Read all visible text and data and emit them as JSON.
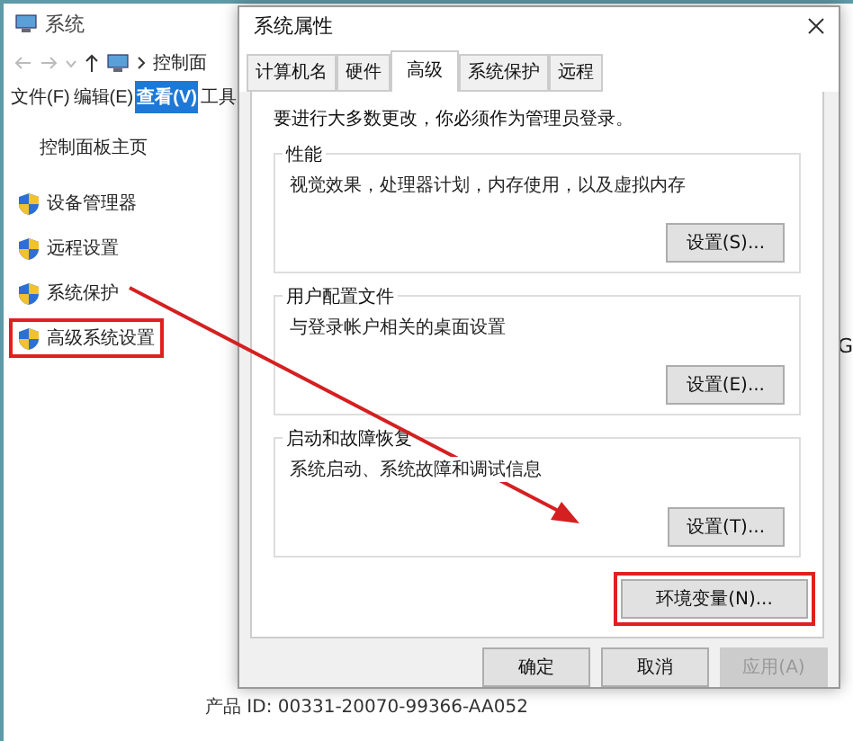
{
  "background_window": {
    "title": "系统",
    "breadcrumb": "控制面",
    "menu": [
      {
        "label": "文件(F)",
        "selected": false
      },
      {
        "label": "编辑(E)",
        "selected": false
      },
      {
        "label": "查看(V)",
        "selected": true
      },
      {
        "label": "工具",
        "selected": false
      }
    ],
    "home_link": "控制面板主页",
    "links": [
      {
        "label": "设备管理器",
        "highlighted": false
      },
      {
        "label": "远程设置",
        "highlighted": false
      },
      {
        "label": "系统保护",
        "highlighted": false
      },
      {
        "label": "高级系统设置",
        "highlighted": true
      }
    ],
    "fragment": "G",
    "product_id": "产品 ID: 00331-20070-99366-AA052"
  },
  "dialog": {
    "title": "系统属性",
    "tabs": [
      {
        "label": "计算机名",
        "selected": false
      },
      {
        "label": "硬件",
        "selected": false
      },
      {
        "label": "高级",
        "selected": true
      },
      {
        "label": "系统保护",
        "selected": false
      },
      {
        "label": "远程",
        "selected": false
      }
    ],
    "notice": "要进行大多数更改，你必须作为管理员登录。",
    "groups": [
      {
        "title": "性能",
        "description": "视觉效果，处理器计划，内存使用，以及虚拟内存",
        "button": "设置(S)..."
      },
      {
        "title": "用户配置文件",
        "description": "与登录帐户相关的桌面设置",
        "button": "设置(E)..."
      },
      {
        "title": "启动和故障恢复",
        "description": "系统启动、系统故障和调试信息",
        "button": "设置(T)..."
      }
    ],
    "env_button": {
      "label": "环境变量(N)...",
      "highlighted": true
    },
    "footer_buttons": [
      {
        "label": "确定",
        "disabled": false
      },
      {
        "label": "取消",
        "disabled": false
      },
      {
        "label": "应用(A)",
        "disabled": true
      }
    ]
  }
}
